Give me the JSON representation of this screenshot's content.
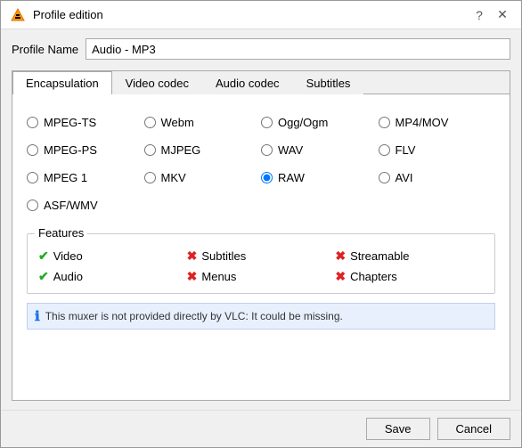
{
  "dialog": {
    "title": "Profile edition",
    "vlc_icon": "▶"
  },
  "title_buttons": {
    "help": "?",
    "close": "✕"
  },
  "profile_name": {
    "label": "Profile Name",
    "value": "Audio - MP3",
    "placeholder": "Profile Name"
  },
  "tabs": [
    {
      "id": "encapsulation",
      "label": "Encapsulation",
      "active": true
    },
    {
      "id": "video_codec",
      "label": "Video codec",
      "active": false
    },
    {
      "id": "audio_codec",
      "label": "Audio codec",
      "active": false
    },
    {
      "id": "subtitles",
      "label": "Subtitles",
      "active": false
    }
  ],
  "encapsulation": {
    "radio_options": [
      {
        "id": "mpeg_ts",
        "label": "MPEG-TS",
        "checked": false
      },
      {
        "id": "webm",
        "label": "Webm",
        "checked": false
      },
      {
        "id": "ogg_ogm",
        "label": "Ogg/Ogm",
        "checked": false
      },
      {
        "id": "mp4_mov",
        "label": "MP4/MOV",
        "checked": false
      },
      {
        "id": "mpeg_ps",
        "label": "MPEG-PS",
        "checked": false
      },
      {
        "id": "mjpeg",
        "label": "MJPEG",
        "checked": false
      },
      {
        "id": "wav",
        "label": "WAV",
        "checked": false
      },
      {
        "id": "flv",
        "label": "FLV",
        "checked": false
      },
      {
        "id": "mpeg1",
        "label": "MPEG 1",
        "checked": false
      },
      {
        "id": "mkv",
        "label": "MKV",
        "checked": false
      },
      {
        "id": "raw",
        "label": "RAW",
        "checked": true
      },
      {
        "id": "avi",
        "label": "AVI",
        "checked": false
      },
      {
        "id": "asf_wmv",
        "label": "ASF/WMV",
        "checked": false
      }
    ],
    "features": {
      "title": "Features",
      "items": [
        {
          "id": "video",
          "label": "Video",
          "enabled": true
        },
        {
          "id": "subtitles",
          "label": "Subtitles",
          "enabled": false
        },
        {
          "id": "streamable",
          "label": "Streamable",
          "enabled": false
        },
        {
          "id": "audio",
          "label": "Audio",
          "enabled": true
        },
        {
          "id": "menus",
          "label": "Menus",
          "enabled": false
        },
        {
          "id": "chapters",
          "label": "Chapters",
          "enabled": false
        }
      ]
    },
    "info_message": "This muxer is not provided directly by VLC: It could be missing."
  },
  "footer": {
    "save_label": "Save",
    "cancel_label": "Cancel"
  }
}
